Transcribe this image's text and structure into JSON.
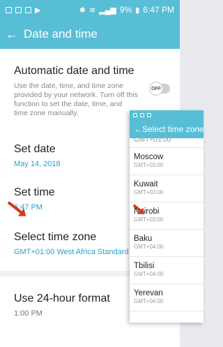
{
  "status_bar": {
    "battery": "9%",
    "time": "6:47 PM"
  },
  "header": {
    "title": "Date and time"
  },
  "settings": {
    "auto_title": "Automatic date and time",
    "auto_desc": "Use the date, time, and time zone provided by your network. Turn off this function to set the date, time, and time zone manually.",
    "auto_toggle": "OFF",
    "set_date_title": "Set date",
    "set_date_value": "May 14, 2018",
    "set_time_title": "Set time",
    "set_time_value": "6:47 PM",
    "zone_title": "Select time zone",
    "zone_value": "GMT+01:00 West Africa Standard",
    "format_title": "Use 24-hour format",
    "format_value": "1:00 PM"
  },
  "timezone_panel": {
    "title": "Select time zone",
    "partial_gmt": "GMT+03:00",
    "items": [
      {
        "city": "Moscow",
        "gmt": "GMT+03:00"
      },
      {
        "city": "Kuwait",
        "gmt": "GMT+03:00"
      },
      {
        "city": "Nairobi",
        "gmt": "GMT+03:00"
      },
      {
        "city": "Baku",
        "gmt": "GMT+04:00"
      },
      {
        "city": "Tbilisi",
        "gmt": "GMT+04:00"
      },
      {
        "city": "Yerevan",
        "gmt": "GMT+04:00"
      }
    ]
  },
  "colors": {
    "accent": "#58bed6",
    "link": "#2a9fd0",
    "arrow": "#d23a1f"
  }
}
